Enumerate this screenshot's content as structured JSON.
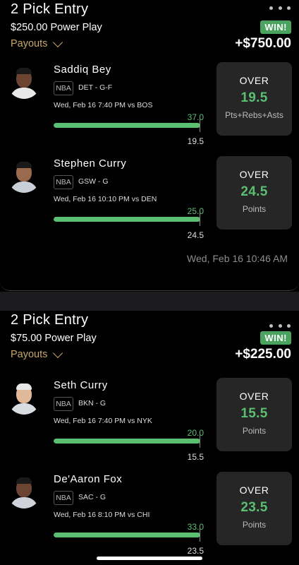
{
  "entries": [
    {
      "title": "2 Pick Entry",
      "wager": "$250.00 Power Play",
      "payouts_label": "Payouts",
      "result_badge": "WIN!",
      "payout": "+$750.00",
      "timestamp": "Wed, Feb 16 10:46 AM",
      "picks": [
        {
          "player": "Saddiq Bey",
          "league": "NBA",
          "team_pos": "DET - G-F",
          "game_time": "Wed, Feb 16 7:40 PM vs BOS",
          "actual": "37.0",
          "line": "19.5",
          "progress": 1.0,
          "direction": "OVER",
          "stat_line": "19.5",
          "stat_type": "Pts+Rebs+Asts"
        },
        {
          "player": "Stephen Curry",
          "league": "NBA",
          "team_pos": "GSW - G",
          "game_time": "Wed, Feb 16 10:10 PM vs DEN",
          "actual": "25.0",
          "line": "24.5",
          "progress": 1.0,
          "direction": "OVER",
          "stat_line": "24.5",
          "stat_type": "Points"
        }
      ]
    },
    {
      "title": "2 Pick Entry",
      "wager": "$75.00 Power Play",
      "payouts_label": "Payouts",
      "result_badge": "WIN!",
      "payout": "+$225.00",
      "picks": [
        {
          "player": "Seth Curry",
          "league": "NBA",
          "team_pos": "BKN - G",
          "game_time": "Wed, Feb 16 7:40 PM vs NYK",
          "actual": "20.0",
          "line": "15.5",
          "progress": 1.0,
          "direction": "OVER",
          "stat_line": "15.5",
          "stat_type": "Points"
        },
        {
          "player": "De'Aaron Fox",
          "league": "NBA",
          "team_pos": "SAC - G",
          "game_time": "Wed, Feb 16 8:10 PM vs CHI",
          "actual": "33.0",
          "line": "23.5",
          "progress": 1.0,
          "direction": "OVER",
          "stat_line": "23.5",
          "stat_type": "Points"
        }
      ]
    }
  ],
  "colors": {
    "accent_green": "#5bbf72",
    "badge_green": "#4aa35e",
    "payouts_gold": "#c8a96a",
    "card_bg": "#000000",
    "stat_box_bg": "#262626"
  },
  "icons": [
    "more-options-icon",
    "chevron-down-icon",
    "player-headshot"
  ]
}
